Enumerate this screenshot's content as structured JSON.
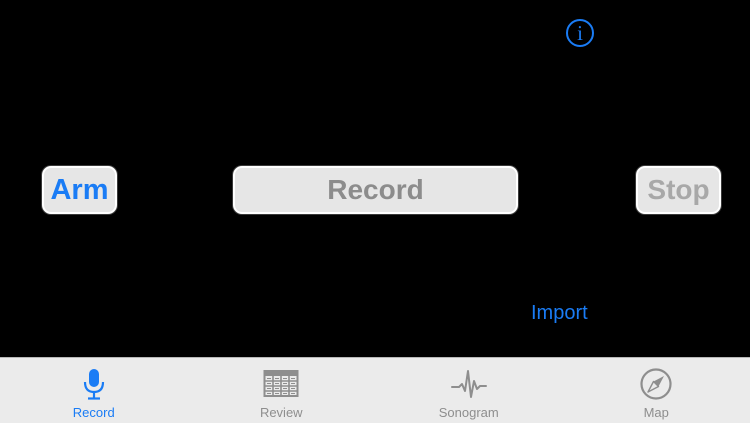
{
  "controls": {
    "info_label": "i",
    "arm_label": "Arm",
    "record_label": "Record",
    "stop_label": "Stop",
    "import_label": "Import"
  },
  "tabs": [
    {
      "label": "Record",
      "icon": "microphone-icon",
      "active": true
    },
    {
      "label": "Review",
      "icon": "table-icon",
      "active": false
    },
    {
      "label": "Sonogram",
      "icon": "waveform-icon",
      "active": false
    },
    {
      "label": "Map",
      "icon": "compass-icon",
      "active": false
    }
  ],
  "colors": {
    "accent": "#1a7cf5",
    "inactive": "#8e8e8e",
    "background": "#000000",
    "tabbar": "#ebebeb"
  }
}
